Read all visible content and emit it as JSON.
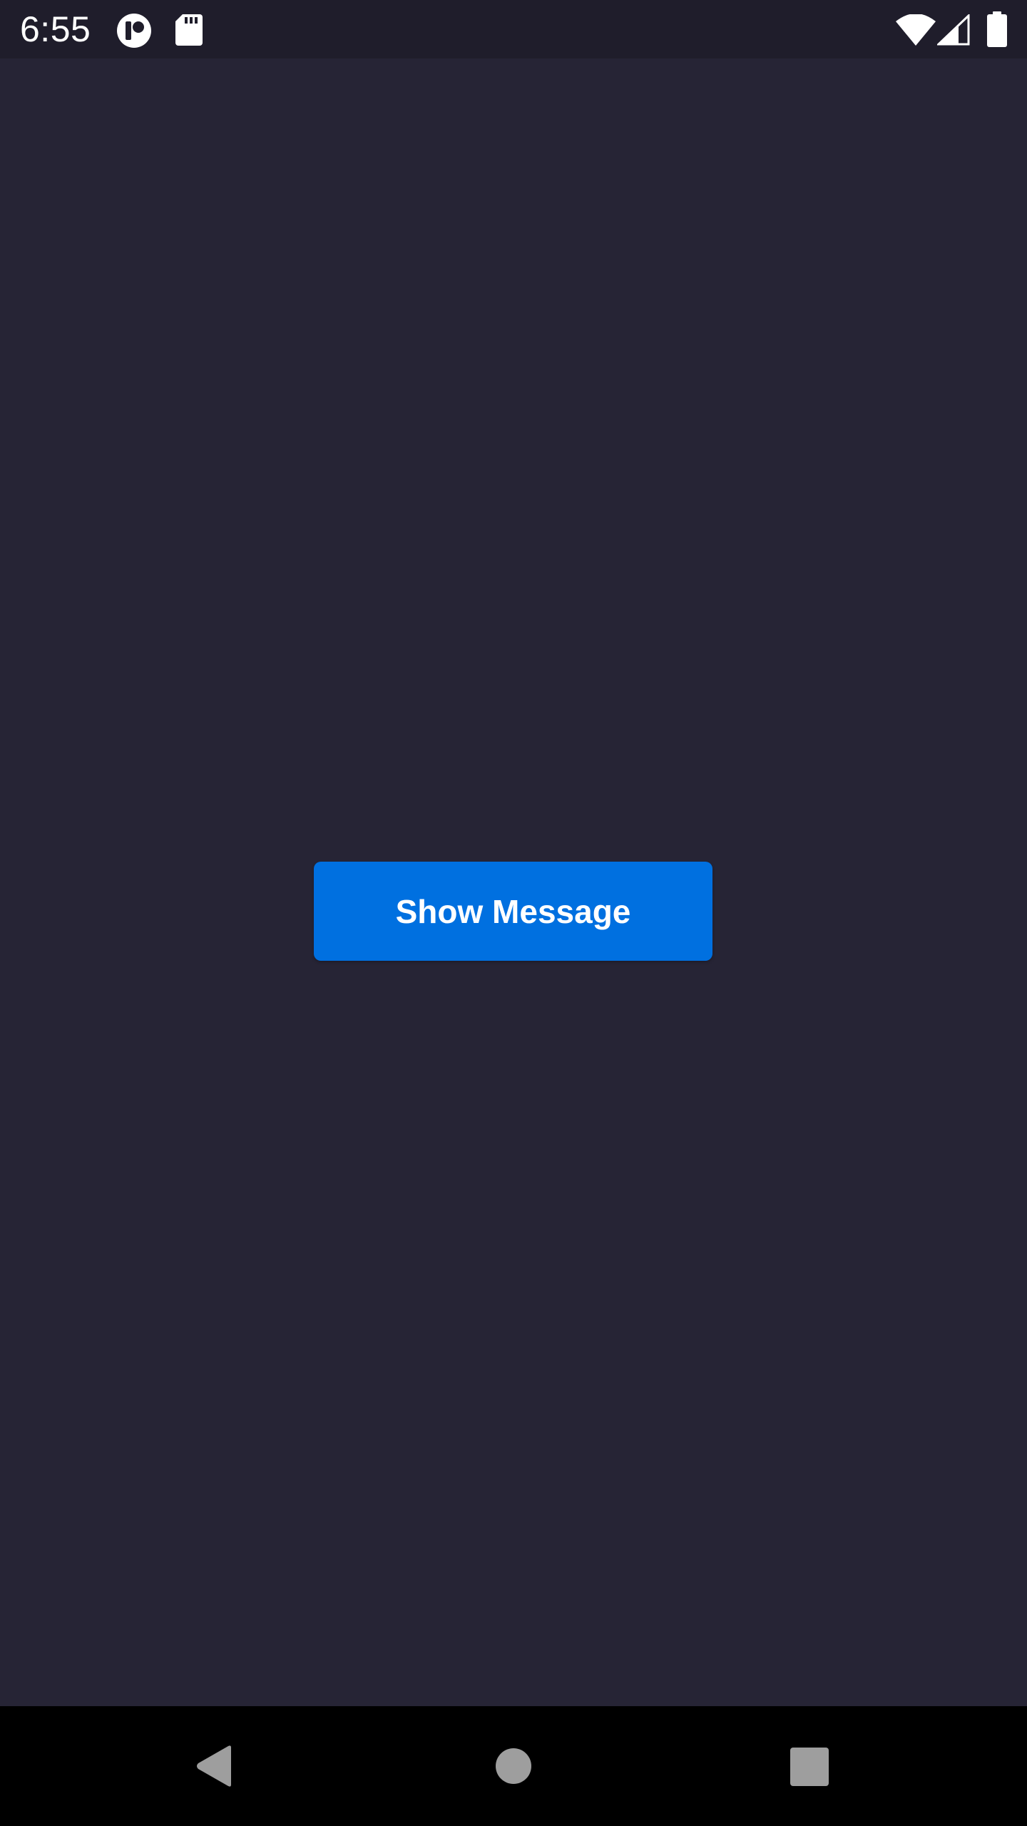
{
  "status_bar": {
    "time": "6:55",
    "icons": [
      "app-notification-icon",
      "sd-card-icon",
      "wifi-icon",
      "cell-signal-icon",
      "battery-icon"
    ]
  },
  "main": {
    "button_label": "Show Message"
  },
  "nav_bar": {
    "buttons": [
      "back-icon",
      "home-icon",
      "recents-icon"
    ]
  },
  "colors": {
    "background": "#262435",
    "status_bar": "#1f1d2b",
    "nav_bar": "#000000",
    "button": "#0070e0",
    "button_text": "#ffffff",
    "nav_icon": "#9e9e9e"
  }
}
